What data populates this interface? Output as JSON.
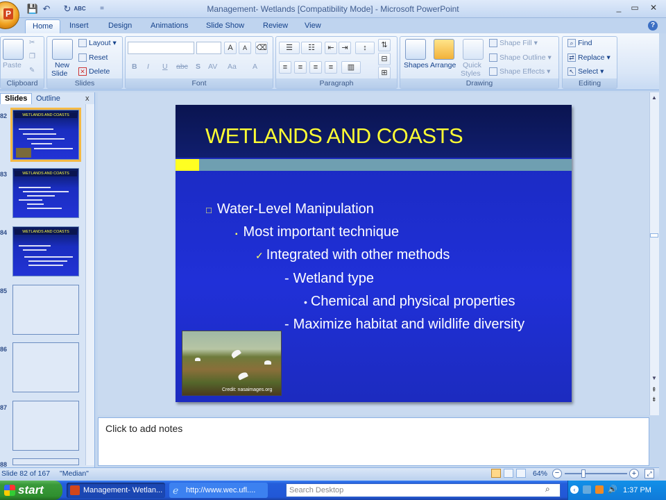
{
  "window": {
    "title": "Management- Wetlands [Compatibility Mode] - Microsoft PowerPoint",
    "minimize": "_",
    "restore": "▭",
    "close": "✕"
  },
  "qat": {
    "save": "💾",
    "undo": "↶",
    "redo": "↻",
    "spell": "ABC",
    "more": "="
  },
  "ribbon_tabs": [
    "Home",
    "Insert",
    "Design",
    "Animations",
    "Slide Show",
    "Review",
    "View"
  ],
  "ribbon": {
    "clipboard": {
      "label": "Clipboard",
      "paste": "Paste"
    },
    "slides": {
      "label": "Slides",
      "new_slide_1": "New",
      "new_slide_2": "Slide",
      "layout": "Layout",
      "reset": "Reset",
      "delete": "Delete"
    },
    "font": {
      "label": "Font",
      "bold": "B",
      "italic": "I",
      "underline": "U",
      "strike": "abc",
      "shadow": "S",
      "spacing": "AV",
      "case": "Aa",
      "color": "A",
      "grow": "A",
      "shrink": "A"
    },
    "paragraph": {
      "label": "Paragraph"
    },
    "drawing": {
      "label": "Drawing",
      "shapes": "Shapes",
      "arrange": "Arrange",
      "quick_styles_1": "Quick",
      "quick_styles_2": "Styles",
      "shape_fill": "Shape Fill",
      "shape_outline": "Shape Outline",
      "shape_effects": "Shape Effects"
    },
    "editing": {
      "label": "Editing",
      "find": "Find",
      "replace": "Replace",
      "select": "Select"
    }
  },
  "left_pane": {
    "tab_slides": "Slides",
    "tab_outline": "Outline",
    "close": "x",
    "thumbnails": [
      {
        "num": "82",
        "title": "WETLANDS AND COASTS",
        "selected": true
      },
      {
        "num": "83",
        "title": "WETLANDS AND COASTS",
        "selected": false
      },
      {
        "num": "84",
        "title": "WETLANDS AND COASTS",
        "selected": false
      },
      {
        "num": "85",
        "title": "",
        "selected": false
      },
      {
        "num": "86",
        "title": "",
        "selected": false
      },
      {
        "num": "87",
        "title": "",
        "selected": false
      },
      {
        "num": "88",
        "title": "",
        "selected": false
      }
    ]
  },
  "slide": {
    "title": "WETLANDS AND COASTS",
    "bullets": [
      {
        "marker": "□",
        "text": "Water-Level Manipulation"
      },
      {
        "marker": "▪",
        "text": "Most important technique"
      },
      {
        "marker": "✓",
        "text": "Integrated with other methods"
      },
      {
        "marker": "-",
        "text": "Wetland type"
      },
      {
        "marker": "•",
        "text": "Chemical and physical properties"
      },
      {
        "marker": "-",
        "text": "Maximize habitat and wildlife diversity"
      }
    ],
    "photo_credit": "Credit: nasaimages.org"
  },
  "notes": {
    "placeholder": "Click to add notes"
  },
  "status": {
    "slide_pos": "Slide 82 of 167",
    "theme": "\"Median\"",
    "zoom": "64%",
    "zoom_minus": "−",
    "zoom_plus": "+"
  },
  "taskbar": {
    "start": "start",
    "tasks": [
      "Management- Wetlan...",
      "http://www.wec.ufl...."
    ],
    "search_placeholder": "Search Desktop",
    "time": "1:37 PM"
  },
  "colors": {
    "slide_title": "#ffff33",
    "accent_yellow": "#ffff22",
    "accent_teal": "#6f9fb1"
  }
}
